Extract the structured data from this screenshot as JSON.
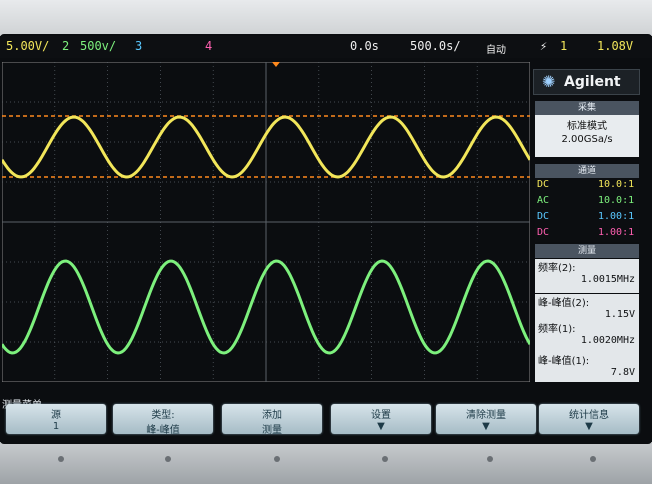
{
  "topbar": {
    "ch1_scale": "5.00V/",
    "ch2_num": "2",
    "ch2_scale": "500v/",
    "ch3_num": "3",
    "ch4_num": "4",
    "time_delay": "0.0s",
    "time_scale": "500.0s/",
    "run_mode": "自动",
    "trigger_icon": "trigger-edge-icon",
    "trigger_source": "1",
    "trigger_level": "1.08V"
  },
  "panel": {
    "brand": "Agilent",
    "acquire_header": "采集",
    "acquire_mode": "标准模式",
    "sample_rate": "2.00GSa/s",
    "channel_header": "通道",
    "channels": [
      {
        "coupling": "DC",
        "probe": "10.0:1",
        "color": "#f2e65a"
      },
      {
        "coupling": "AC",
        "probe": "10.0:1",
        "color": "#7df07d"
      },
      {
        "coupling": "DC",
        "probe": "1.00:1",
        "color": "#59c8ff"
      },
      {
        "coupling": "DC",
        "probe": "1.00:1",
        "color": "#ff5fb0"
      }
    ],
    "measure_header": "测量",
    "measurements": [
      {
        "label": "频率(2):",
        "value": "1.0015MHz"
      },
      {
        "label": "峰-峰值(2):",
        "value": "1.15V"
      },
      {
        "label": "频率(1):",
        "value": "1.0020MHz"
      },
      {
        "label": "峰-峰值(1):",
        "value": "7.8V"
      }
    ]
  },
  "softkeys": {
    "menu_title": "测量菜单",
    "keys": [
      {
        "line1": "源",
        "line2": "1"
      },
      {
        "line1": "类型:",
        "line2": "峰-峰值"
      },
      {
        "line1": "添加",
        "line2": "测量"
      },
      {
        "line1": "设置",
        "line2": ""
      },
      {
        "line1": "清除测量",
        "line2": ""
      },
      {
        "line1": "统计信息",
        "line2": ""
      }
    ]
  },
  "colors": {
    "ch1": "#f2e65a",
    "ch2": "#7df07d",
    "ch3": "#59c8ff",
    "ch4": "#ff5fb0",
    "trigger_line": "#ff8a1e",
    "grid": "#5b6168"
  },
  "traces": {
    "ch1_cycles": 5,
    "ch2_cycles": 5
  }
}
